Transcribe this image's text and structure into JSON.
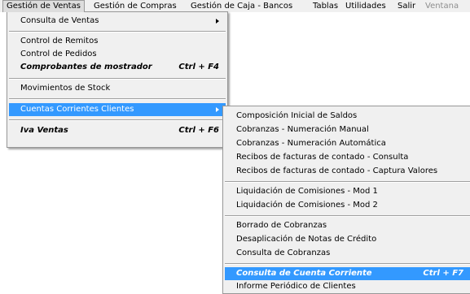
{
  "menubar": {
    "items": [
      {
        "label": "Gestión de Ventas"
      },
      {
        "label": "Gestión de Compras"
      },
      {
        "label": "Gestión de Caja - Bancos"
      },
      {
        "label": "Tablas"
      },
      {
        "label": "Utilidades"
      },
      {
        "label": "Salir"
      },
      {
        "label": "Ventana"
      }
    ]
  },
  "ventas_menu": {
    "items": [
      {
        "label": "Consulta de Ventas"
      },
      {
        "label": "Control de Remitos"
      },
      {
        "label": "Control de Pedidos"
      },
      {
        "label": "Comprobantes de mostrador",
        "shortcut": "Ctrl + F4"
      },
      {
        "label": "Movimientos de Stock"
      },
      {
        "label": "Cuentas Corrientes Clientes"
      },
      {
        "label": "Iva Ventas",
        "shortcut": "Ctrl + F6"
      }
    ]
  },
  "cuentas_submenu": {
    "items": [
      {
        "label": "Composición Inicial de Saldos"
      },
      {
        "label": "Cobranzas - Numeración Manual"
      },
      {
        "label": "Cobranzas - Numeración Automática"
      },
      {
        "label": "Recibos de facturas de contado - Consulta"
      },
      {
        "label": "Recibos de facturas de contado - Captura Valores"
      },
      {
        "label": "Liquidación de Comisiones - Mod 1"
      },
      {
        "label": "Liquidación de Comisiones - Mod 2"
      },
      {
        "label": "Borrado de Cobranzas"
      },
      {
        "label": "Desaplicación de Notas de Crédito"
      },
      {
        "label": "Consulta de Cobranzas"
      },
      {
        "label": "Consulta de Cuenta Corriente",
        "shortcut": "Ctrl + F7"
      },
      {
        "label": "Informe Periódico de Clientes"
      }
    ]
  },
  "colors": {
    "highlight": "#3399ff",
    "menu_bg": "#f0f0f0",
    "disabled_text": "#8e8e8e"
  }
}
